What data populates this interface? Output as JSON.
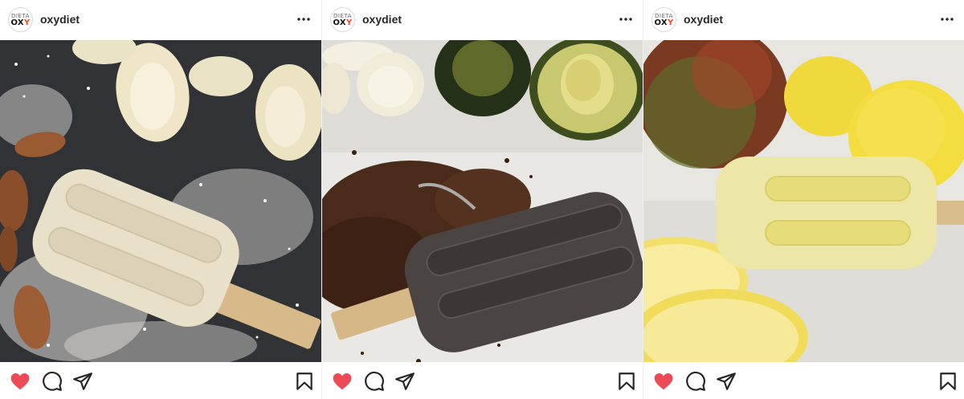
{
  "posts": [
    {
      "username": "oxydiet",
      "avatar": {
        "line1": "DIETA",
        "line2": "OXY"
      },
      "photo_icon": "banana-coconut-popsicle-photo",
      "liked": true
    },
    {
      "username": "oxydiet",
      "avatar": {
        "line1": "DIETA",
        "line2": "OXY"
      },
      "photo_icon": "cocoa-avocado-popsicle-photo",
      "liked": true
    },
    {
      "username": "oxydiet",
      "avatar": {
        "line1": "DIETA",
        "line2": "OXY"
      },
      "photo_icon": "mango-lemon-popsicle-photo",
      "liked": true
    }
  ],
  "icons": {
    "more": "more-options-icon",
    "like": "heart-icon",
    "comment": "comment-icon",
    "share": "share-icon",
    "save": "bookmark-icon"
  },
  "colors": {
    "like_red": "#ed4956",
    "text": "#262626",
    "brand_orange": "#e84e2a"
  }
}
